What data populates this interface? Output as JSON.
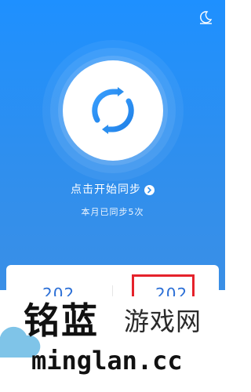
{
  "header": {
    "night_mode_icon": "moon-icon"
  },
  "sync": {
    "icon": "sync-refresh-icon",
    "start_label": "点击开始同步",
    "start_arrow_icon": "chevron-right-icon",
    "count_label": "本月已同步5次"
  },
  "stats": {
    "left_value": "202",
    "right_value": "202"
  },
  "watermark": {
    "brand_cn": "铭蓝",
    "brand_cn_suffix": "游戏网",
    "brand_en": "minglan.cc"
  },
  "colors": {
    "primary_blue": "#1e90ff",
    "stat_blue": "#2b6fd6",
    "highlight_red": "#e5222b"
  }
}
